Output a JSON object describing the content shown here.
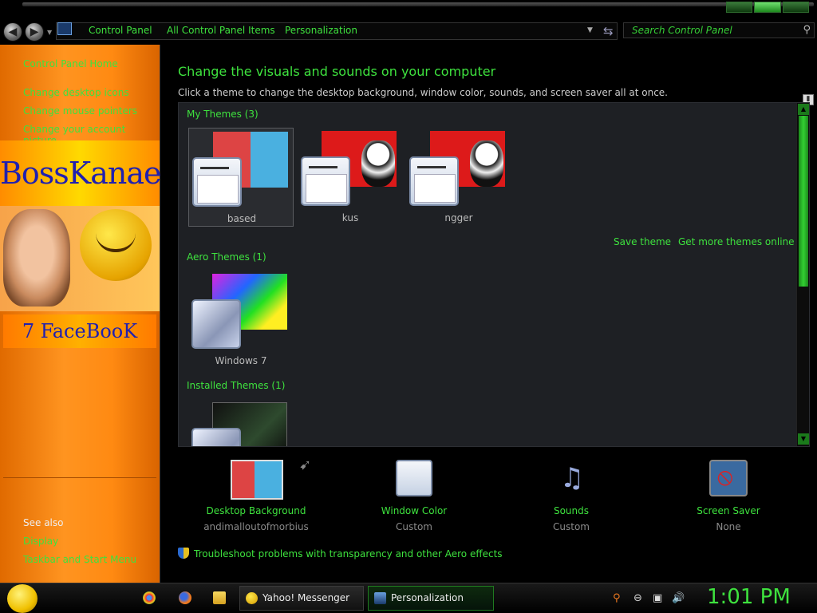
{
  "addressbar": {
    "breadcrumbs": [
      "Control Panel",
      "All Control Panel Items",
      "Personalization"
    ],
    "search_placeholder": "Search Control Panel"
  },
  "sidebar": {
    "links": [
      "Control Panel Home",
      "Change desktop icons",
      "Change mouse pointers",
      "Change your account picture"
    ],
    "banner_title": "BossKanae",
    "banner_caption": "7 FaceBooK",
    "see_also_label": "See also",
    "see_also_links": [
      "Display",
      "Taskbar and Start Menu"
    ]
  },
  "main": {
    "heading": "Change the visuals and sounds on your computer",
    "subtext": "Click a theme to change the desktop background, window color, sounds, and screen saver all at once.",
    "groups": {
      "my": "My Themes (3)",
      "aero": "Aero Themes (1)",
      "installed": "Installed Themes (1)"
    },
    "my_themes": [
      "based",
      "kus",
      "ngger"
    ],
    "aero_themes": [
      "Windows 7"
    ],
    "save_theme": "Save theme",
    "get_more": "Get more themes online",
    "bottom": [
      {
        "label": "Desktop Background",
        "value": "andimalloutofmorbius"
      },
      {
        "label": "Window Color",
        "value": "Custom"
      },
      {
        "label": "Sounds",
        "value": "Custom"
      },
      {
        "label": "Screen Saver",
        "value": "None"
      }
    ],
    "troubleshoot": "Troubleshoot problems with transparency and other Aero effects"
  },
  "taskbar": {
    "tasks": [
      "Yahoo! Messenger",
      "Personalization"
    ],
    "clock": "1:01 PM"
  },
  "colors": {
    "accent": "#3ee23e",
    "sidebar": "#ff8a12",
    "panel": "#1e2024"
  }
}
